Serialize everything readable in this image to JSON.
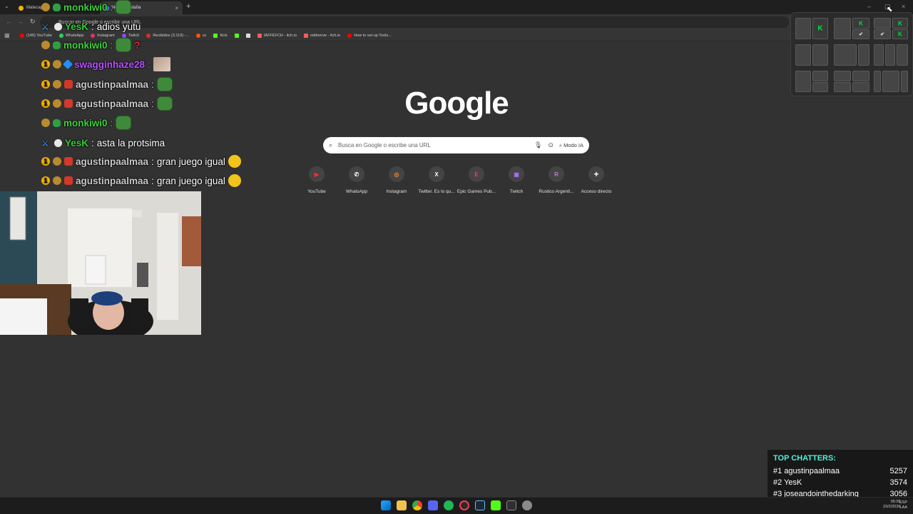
{
  "browser": {
    "tabs": [
      {
        "label": "Matecapp",
        "active": false
      },
      {
        "label": "Buscar en Google o escribir una URL",
        "active": true
      },
      {
        "label": "Nueva pestaña",
        "active": false
      }
    ],
    "omnibox_text": "Buscar en Google o escribir una URL",
    "bookmarks": [
      {
        "label": "(146) YouTube",
        "color": "#ff0000"
      },
      {
        "label": "WhatsApp",
        "color": "#25d366"
      },
      {
        "label": "Instagram",
        "color": "#e1306c"
      },
      {
        "label": "Twitch",
        "color": "#9146ff"
      },
      {
        "label": "Recibidos (3.119) -...",
        "color": "#d93025"
      },
      {
        "label": "sc",
        "color": "#ff5500"
      },
      {
        "label": "Kick",
        "color": "#53fc18"
      },
      {
        "label": "",
        "color": "#53fc18"
      },
      {
        "label": "",
        "color": "#dddddd"
      },
      {
        "label": "IAFFEFCH - itch.io",
        "color": "#fa5c5c"
      },
      {
        "label": "oddnerve - itch.io",
        "color": "#fa5c5c"
      },
      {
        "label": "How to set up Tools...",
        "color": "#ff0000"
      }
    ]
  },
  "google": {
    "logo": "Google",
    "search_placeholder": "Busca en Google o escribe una URL",
    "modo_ia": "Modo IA",
    "shortcuts": [
      {
        "label": "YouTube",
        "letter": "▶",
        "color": "#ff2d2d"
      },
      {
        "label": "WhatsApp",
        "letter": "✆",
        "color": "#ffffff"
      },
      {
        "label": "Instagram",
        "letter": "◎",
        "color": "#f58529"
      },
      {
        "label": "Twitter. Es lo qu...",
        "letter": "X",
        "color": "#ffffff"
      },
      {
        "label": "Epic Games Pub...",
        "letter": "E",
        "color": "#e8456a"
      },
      {
        "label": "Twitch",
        "letter": "▣",
        "color": "#a970ff"
      },
      {
        "label": "Rustico Argenti...",
        "letter": "R",
        "color": "#c07adc"
      },
      {
        "label": "Acceso directo",
        "letter": "+",
        "color": "#ffffff"
      }
    ]
  },
  "chat": [
    {
      "user": "monkiwi0",
      "color": "#3ecf3e",
      "badges": [
        "gem",
        "alien"
      ],
      "text": "",
      "emote": "pepe"
    },
    {
      "user": "YesK",
      "color": "#33cc33",
      "badges": [
        "sword",
        "ghost"
      ],
      "text": "adios yutu",
      "emote": ""
    },
    {
      "user": "monkiwi0",
      "color": "#3ecf3e",
      "badges": [
        "gem",
        "alien"
      ],
      "text": "",
      "emote": "pepe-question"
    },
    {
      "user": "swagginhaze28",
      "color": "#b84dff",
      "badges": [
        "one",
        "gem",
        "dia"
      ],
      "text": "",
      "emote": "thumb"
    },
    {
      "user": "agustinpaalmaa",
      "color": "#c9c9c9",
      "badges": [
        "one",
        "gem",
        "wolf"
      ],
      "text": "",
      "emote": "pepe"
    },
    {
      "user": "agustinpaalmaa",
      "color": "#c9c9c9",
      "badges": [
        "one",
        "gem",
        "wolf"
      ],
      "text": "",
      "emote": "pepe"
    },
    {
      "user": "monkiwi0",
      "color": "#3ecf3e",
      "badges": [
        "gem",
        "alien"
      ],
      "text": "",
      "emote": "pepe"
    },
    {
      "user": "YesK",
      "color": "#33cc33",
      "badges": [
        "sword",
        "ghost"
      ],
      "text": "asta la protsima",
      "emote": ""
    },
    {
      "user": "agustinpaalmaa",
      "color": "#c9c9c9",
      "badges": [
        "one",
        "gem",
        "wolf"
      ],
      "text": "gran juego igual",
      "emote": "yellow"
    },
    {
      "user": "agustinpaalmaa",
      "color": "#c9c9c9",
      "badges": [
        "one",
        "gem",
        "wolf"
      ],
      "text": "gran juego igual",
      "emote": "yellow"
    }
  ],
  "top_chatters": {
    "title": "TOP CHATTERS:",
    "rows": [
      {
        "rank": "#1",
        "name": "agustinpaalmaa",
        "count": "5257"
      },
      {
        "rank": "#2",
        "name": "YesK",
        "count": "3574"
      },
      {
        "rank": "#3",
        "name": "joseandointhedarking",
        "count": "3056"
      }
    ]
  },
  "tray": {
    "lang": "ESP",
    "layout": "LAA",
    "time": "05:09",
    "date": "23/2/2026"
  }
}
